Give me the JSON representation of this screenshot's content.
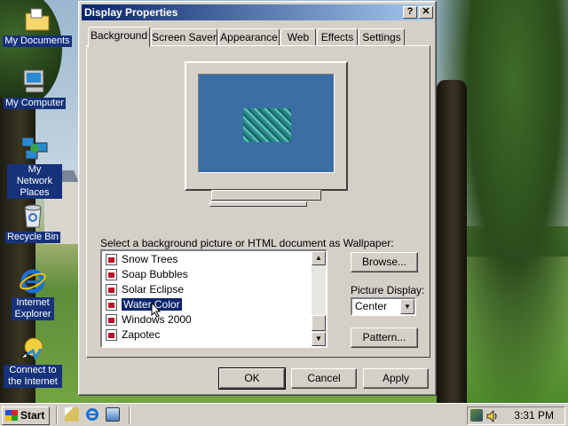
{
  "desktop": {
    "icons": [
      {
        "label": "My Documents",
        "icon": "folder-docs-icon"
      },
      {
        "label": "My Computer",
        "icon": "computer-icon"
      },
      {
        "label_line1": "My Network",
        "label_line2": "Places",
        "icon": "network-places-icon"
      },
      {
        "label": "Recycle Bin",
        "icon": "recycle-bin-icon"
      },
      {
        "label_line1": "Internet",
        "label_line2": "Explorer",
        "icon": "ie-icon"
      },
      {
        "label_line1": "Connect to",
        "label_line2": "the Internet",
        "icon": "connect-internet-icon"
      }
    ]
  },
  "dialog": {
    "title": "Display Properties",
    "help_btn": "?",
    "close_btn": "✕",
    "tabs": [
      {
        "label": "Background",
        "active": true
      },
      {
        "label": "Screen Saver"
      },
      {
        "label": "Appearance"
      },
      {
        "label": "Web"
      },
      {
        "label": "Effects"
      },
      {
        "label": "Settings"
      }
    ],
    "prompt": "Select a background picture or HTML document as Wallpaper:",
    "wallpapers": [
      {
        "label": "Snow Trees"
      },
      {
        "label": "Soap Bubbles"
      },
      {
        "label": "Solar Eclipse"
      },
      {
        "label": "Water Color",
        "selected": true
      },
      {
        "label": "Windows 2000"
      },
      {
        "label": "Zapotec"
      }
    ],
    "browse_btn": "Browse...",
    "picture_display_label": "Picture Display:",
    "picture_display_value": "Center",
    "pattern_btn": "Pattern...",
    "ok_btn": "OK",
    "cancel_btn": "Cancel",
    "apply_btn": "Apply",
    "colors": {
      "title_start": "#0a246a",
      "title_end": "#a6caf0",
      "preview_bg": "#3a6ea5"
    }
  },
  "taskbar": {
    "start_label": "Start",
    "clock": "3:31 PM"
  }
}
